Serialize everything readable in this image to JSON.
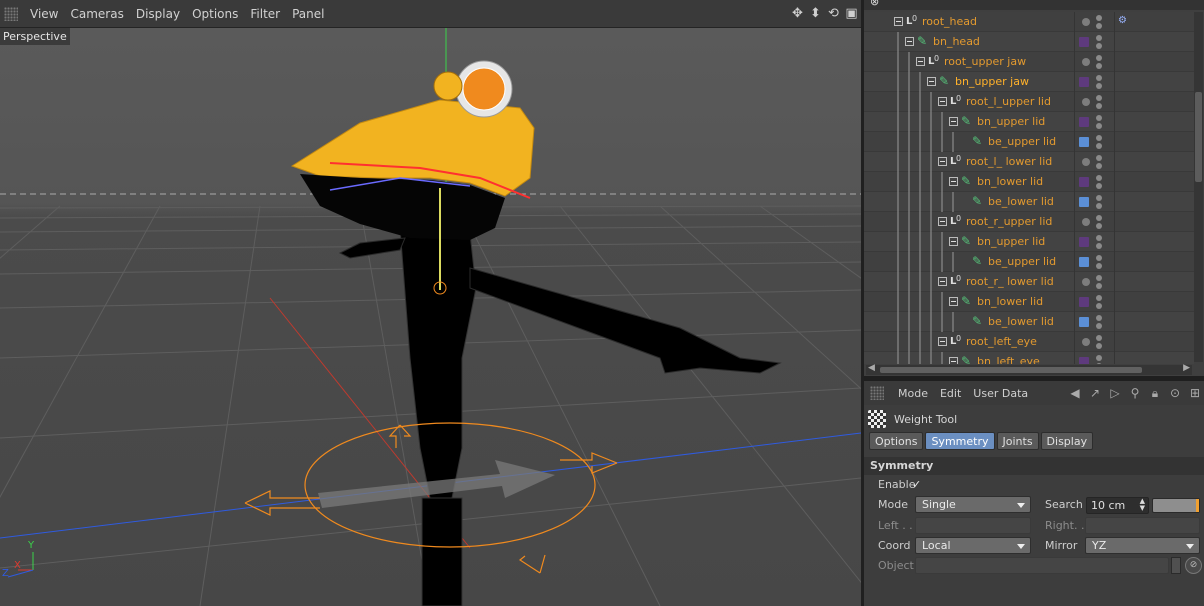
{
  "menubar": {
    "items": [
      "View",
      "Cameras",
      "Display",
      "Options",
      "Filter",
      "Panel"
    ]
  },
  "viewport": {
    "label": "Perspective",
    "axis_labels": {
      "y": "Y",
      "x": "X",
      "z": "Z"
    },
    "colors": {
      "model": "#f2b320",
      "selection": "#f08a1e",
      "x_axis": "#e03a2e",
      "y_axis": "#3bd34a",
      "z_axis": "#2f5be0"
    }
  },
  "nav_icons": [
    "move-view-icon",
    "zoom-view-icon",
    "rotate-view-icon",
    "maximize-view-icon"
  ],
  "object_manager": {
    "rows": [
      {
        "name": "root_head",
        "type": "null",
        "depth": 0,
        "active": false,
        "color": "",
        "tag": "ik-tag-icon"
      },
      {
        "name": "bn_head",
        "type": "bone",
        "depth": 1,
        "active": false,
        "color": "#5e3a7d"
      },
      {
        "name": "root_upper jaw",
        "type": "null",
        "depth": 2,
        "active": false,
        "color": ""
      },
      {
        "name": "bn_upper jaw",
        "type": "bone",
        "depth": 3,
        "active": true,
        "color": "#5e3a7d"
      },
      {
        "name": "root_l_upper lid",
        "type": "null",
        "depth": 4,
        "active": false,
        "color": ""
      },
      {
        "name": "bn_upper lid",
        "type": "bone",
        "depth": 5,
        "active": false,
        "color": "#5e3a7d"
      },
      {
        "name": "be_upper lid",
        "type": "bone-end",
        "depth": 6,
        "active": false,
        "color": "#5b8fd6"
      },
      {
        "name": "root_l_ lower lid",
        "type": "null",
        "depth": 4,
        "active": false,
        "color": ""
      },
      {
        "name": "bn_lower lid",
        "type": "bone",
        "depth": 5,
        "active": false,
        "color": "#5e3a7d"
      },
      {
        "name": "be_lower lid",
        "type": "bone-end",
        "depth": 6,
        "active": false,
        "color": "#5b8fd6"
      },
      {
        "name": "root_r_upper lid",
        "type": "null",
        "depth": 4,
        "active": false,
        "color": ""
      },
      {
        "name": "bn_upper lid",
        "type": "bone",
        "depth": 5,
        "active": false,
        "color": "#5e3a7d"
      },
      {
        "name": "be_upper lid",
        "type": "bone-end",
        "depth": 6,
        "active": false,
        "color": "#5b8fd6"
      },
      {
        "name": "root_r_ lower lid",
        "type": "null",
        "depth": 4,
        "active": false,
        "color": ""
      },
      {
        "name": "bn_lower lid",
        "type": "bone",
        "depth": 5,
        "active": false,
        "color": "#5e3a7d"
      },
      {
        "name": "be_lower lid",
        "type": "bone-end",
        "depth": 6,
        "active": false,
        "color": "#5b8fd6"
      },
      {
        "name": "root_left_eye",
        "type": "null",
        "depth": 4,
        "active": false,
        "color": ""
      },
      {
        "name": "bn_left_eye",
        "type": "bone",
        "depth": 5,
        "active": false,
        "color": "#5e3a7d"
      }
    ]
  },
  "attribute_manager": {
    "menu": [
      "Mode",
      "Edit",
      "User Data"
    ],
    "tool_icons": [
      "back-arrow-icon",
      "up-arrow-icon",
      "forward-arrow-icon",
      "search-icon",
      "lock-icon",
      "link-icon",
      "new-panel-icon"
    ],
    "title": "Weight Tool",
    "tabs": [
      "Options",
      "Symmetry",
      "Joints",
      "Display"
    ],
    "active_tab": "Symmetry",
    "section": "Symmetry",
    "fields": {
      "enable_label": "Enable",
      "enable_mark": "✓",
      "mode_label": "Mode",
      "mode_value": "Single",
      "search_label": "Search",
      "search_value": "10 cm",
      "left_label": "Left . .",
      "right_label": "Right. .",
      "coord_label": "Coord",
      "coord_value": "Local",
      "mirror_label": "Mirror",
      "mirror_value": "YZ",
      "object_label": "Object"
    }
  }
}
